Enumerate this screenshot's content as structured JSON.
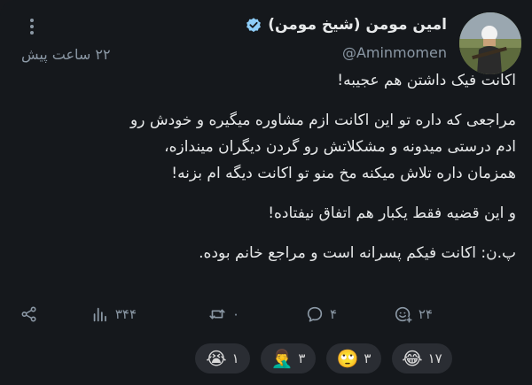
{
  "author": {
    "name": "امین مومن (شیخ مومن)",
    "handle": "@Aminmomen",
    "verified_color": "#8ecdf8"
  },
  "time_ago": "۲۲ ساعت پیش",
  "tweet": {
    "lines": [
      "اکانت فیک داشتن هم عجیبه!",
      "",
      "مراجعی که داره تو این اکانت ازم مشاوره میگیره و خودش رو",
      "ادم درستی میدونه و مشکلاتش رو گردن دیگران میندازه،",
      "همزمان داره تلاش میکنه مخ منو تو اکانت دیگه ام بزنه!",
      "",
      "و این قضیه فقط یکبار هم اتفاق نیفتاده!",
      "",
      "پ.ن: اکانت فیکم پسرانه است و مراجع خانم بوده."
    ]
  },
  "actions": {
    "reactions_count": "۲۴",
    "replies_count": "۴",
    "retweets_count": "۰",
    "views_count": "۳۴۴"
  },
  "emoji_reactions": [
    {
      "emoji": "😂",
      "count": "۱۷"
    },
    {
      "emoji": "🙄",
      "count": "۳"
    },
    {
      "emoji": "🤦‍♂️",
      "count": "۳"
    },
    {
      "emoji": "😭",
      "count": "۱"
    }
  ],
  "icons": {
    "more": "more-vertical-icon",
    "reaction": "add-reaction-icon",
    "reply": "reply-icon",
    "retweet": "retweet-icon",
    "views": "views-icon",
    "share": "share-icon"
  }
}
